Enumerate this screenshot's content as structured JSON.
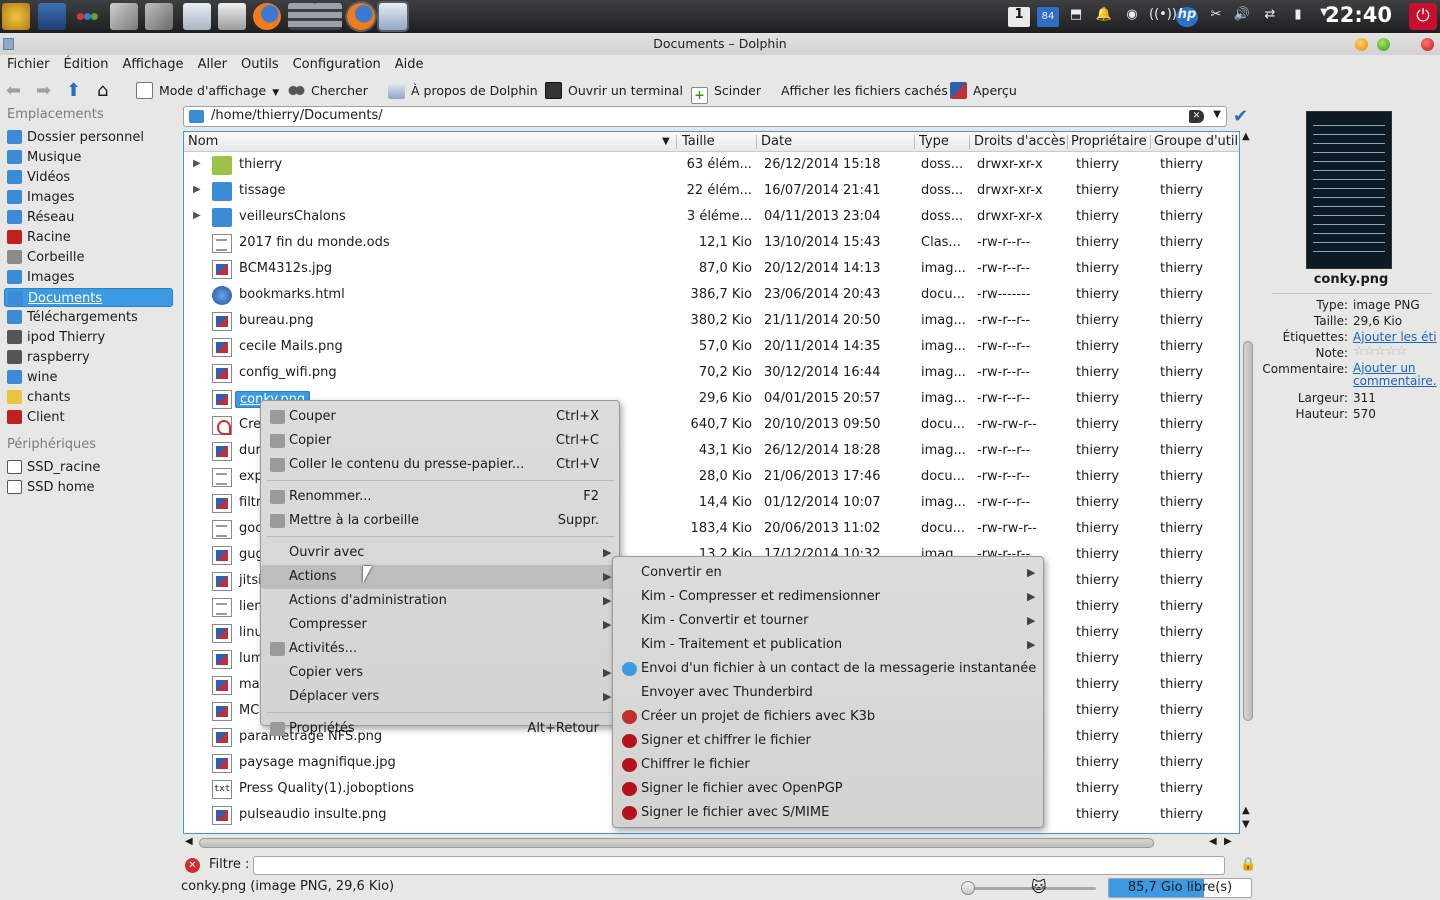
{
  "taskbar": {
    "clock": "22:40",
    "workspace": "1",
    "tray_badge": "84",
    "power_glyph": "⏻"
  },
  "window": {
    "title": "Documents – Dolphin"
  },
  "menubar": [
    "Fichier",
    "Édition",
    "Affichage",
    "Aller",
    "Outils",
    "Configuration",
    "Aide"
  ],
  "toolbar": {
    "view_mode": "Mode d'affichage",
    "search": "Chercher",
    "about": "À propos de Dolphin",
    "terminal": "Ouvrir un terminal",
    "split": "Scinder",
    "hidden": "Afficher les fichiers cachés",
    "preview": "Aperçu"
  },
  "places": {
    "header": "Emplacements",
    "items": [
      {
        "label": "Dossier personnel",
        "icon": "home-folder-icon",
        "color": "#3b8bd6"
      },
      {
        "label": "Musique",
        "icon": "music-folder-icon",
        "color": "#3b8bd6"
      },
      {
        "label": "Vidéos",
        "icon": "videos-folder-icon",
        "color": "#3b8bd6"
      },
      {
        "label": "Images",
        "icon": "pictures-folder-icon",
        "color": "#3b8bd6"
      },
      {
        "label": "Réseau",
        "icon": "network-icon",
        "color": "#3b8bd6"
      },
      {
        "label": "Racine",
        "icon": "root-folder-icon",
        "color": "#c21f1f"
      },
      {
        "label": "Corbeille",
        "icon": "trash-icon",
        "color": "#8c8c8c"
      },
      {
        "label": "Images",
        "icon": "pictures-folder-icon",
        "color": "#3b8bd6"
      },
      {
        "label": "Documents",
        "icon": "documents-folder-icon",
        "color": "#3b8bd6",
        "selected": true
      },
      {
        "label": "Téléchargements",
        "icon": "downloads-folder-icon",
        "color": "#3b8bd6"
      },
      {
        "label": "ipod Thierry",
        "icon": "media-player-icon",
        "color": "#555555"
      },
      {
        "label": "raspberry",
        "icon": "folder-icon",
        "color": "#555555"
      },
      {
        "label": "wine",
        "icon": "folder-icon",
        "color": "#3b8bd6"
      },
      {
        "label": "chants",
        "icon": "folder-icon",
        "color": "#e6c640"
      },
      {
        "label": "Client",
        "icon": "folder-icon",
        "color": "#c21f1f"
      }
    ],
    "devices_header": "Périphériques",
    "devices": [
      {
        "label": "SSD_racine",
        "icon": "drive-icon"
      },
      {
        "label": "SSD home",
        "icon": "drive-icon"
      }
    ]
  },
  "location": {
    "path": "/home/thierry/Documents/"
  },
  "columns": {
    "name": "Nom",
    "size": "Taille",
    "date": "Date",
    "type": "Type",
    "perms": "Droits d'accès",
    "owner": "Propriétaire",
    "group": "Groupe d'util"
  },
  "files": [
    {
      "name": "thierry",
      "size": "63 élém...",
      "date": "26/12/2014 15:18",
      "type": "doss...",
      "perms": "drwxr-xr-x",
      "owner": "thierry",
      "group": "thierry",
      "kind": "folder-green",
      "expander": true
    },
    {
      "name": "tissage",
      "size": "22 élém...",
      "date": "16/07/2014 21:41",
      "type": "doss...",
      "perms": "drwxr-xr-x",
      "owner": "thierry",
      "group": "thierry",
      "kind": "folder",
      "expander": true
    },
    {
      "name": "veilleursChalons",
      "size": "3 éléme...",
      "date": "04/11/2013 23:04",
      "type": "doss...",
      "perms": "drwxr-xr-x",
      "owner": "thierry",
      "group": "thierry",
      "kind": "folder",
      "expander": true
    },
    {
      "name": "2017 fin du monde.ods",
      "size": "12,1 Kio",
      "date": "13/10/2014 15:43",
      "type": "Clas...",
      "perms": "-rw-r--r--",
      "owner": "thierry",
      "group": "thierry",
      "kind": "doc"
    },
    {
      "name": "BCM4312s.jpg",
      "size": "87,0 Kio",
      "date": "20/12/2014 14:13",
      "type": "imag...",
      "perms": "-rw-r--r--",
      "owner": "thierry",
      "group": "thierry",
      "kind": "img"
    },
    {
      "name": "bookmarks.html",
      "size": "386,7 Kio",
      "date": "23/06/2014 20:43",
      "type": "docu...",
      "perms": "-rw-------",
      "owner": "thierry",
      "group": "thierry",
      "kind": "web"
    },
    {
      "name": "bureau.png",
      "size": "380,2 Kio",
      "date": "21/11/2014 20:50",
      "type": "imag...",
      "perms": "-rw-r--r--",
      "owner": "thierry",
      "group": "thierry",
      "kind": "img"
    },
    {
      "name": "cecile Mails.png",
      "size": "57,0 Kio",
      "date": "20/11/2014 14:35",
      "type": "imag...",
      "perms": "-rw-r--r--",
      "owner": "thierry",
      "group": "thierry",
      "kind": "img"
    },
    {
      "name": "config_wifi.png",
      "size": "70,2 Kio",
      "date": "30/12/2014 16:44",
      "type": "imag...",
      "perms": "-rw-r--r--",
      "owner": "thierry",
      "group": "thierry",
      "kind": "img"
    },
    {
      "name": "conky.png",
      "size": "29,6 Kio",
      "date": "04/01/2015 20:57",
      "type": "imag...",
      "perms": "-rw-r--r--",
      "owner": "thierry",
      "group": "thierry",
      "kind": "img",
      "selected": true
    },
    {
      "name": "Cre",
      "size": "640,7 Kio",
      "date": "20/10/2013 09:50",
      "type": "docu...",
      "perms": "-rw-rw-r--",
      "owner": "thierry",
      "group": "thierry",
      "kind": "pdf"
    },
    {
      "name": "dur",
      "size": "43,1 Kio",
      "date": "26/12/2014 18:28",
      "type": "imag...",
      "perms": "-rw-r--r--",
      "owner": "thierry",
      "group": "thierry",
      "kind": "img"
    },
    {
      "name": "exp",
      "size": "28,0 Kio",
      "date": "21/06/2013 17:46",
      "type": "docu...",
      "perms": "-rw-r--r--",
      "owner": "thierry",
      "group": "thierry",
      "kind": "doc"
    },
    {
      "name": "filtr",
      "size": "14,4 Kio",
      "date": "01/12/2014 10:07",
      "type": "imag...",
      "perms": "-rw-r--r--",
      "owner": "thierry",
      "group": "thierry",
      "kind": "img"
    },
    {
      "name": "goo",
      "size": "183,4 Kio",
      "date": "20/06/2013 11:02",
      "type": "docu...",
      "perms": "-rw-rw-r--",
      "owner": "thierry",
      "group": "thierry",
      "kind": "doc"
    },
    {
      "name": "gug",
      "size": "13,2 Kio",
      "date": "17/12/2014 10:32",
      "type": "imag...",
      "perms": "-rw-r--r--",
      "owner": "thierry",
      "group": "thierry",
      "kind": "img"
    },
    {
      "name": "jitsi",
      "size": "",
      "date": "",
      "type": "",
      "perms": "",
      "owner": "thierry",
      "group": "thierry",
      "kind": "img"
    },
    {
      "name": "lien",
      "size": "",
      "date": "",
      "type": "",
      "perms": "",
      "owner": "thierry",
      "group": "thierry",
      "kind": "doc"
    },
    {
      "name": "linu",
      "size": "",
      "date": "",
      "type": "",
      "perms": "",
      "owner": "thierry",
      "group": "thierry",
      "kind": "img"
    },
    {
      "name": "lum",
      "size": "",
      "date": "",
      "type": "",
      "perms": "",
      "owner": "thierry",
      "group": "thierry",
      "kind": "img"
    },
    {
      "name": "mar",
      "size": "",
      "date": "",
      "type": "",
      "perms": "",
      "owner": "thierry",
      "group": "thierry",
      "kind": "img"
    },
    {
      "name": "MCC",
      "size": "",
      "date": "",
      "type": "",
      "perms": "",
      "owner": "thierry",
      "group": "thierry",
      "kind": "img"
    },
    {
      "name": "parametrage NFS.png",
      "size": "",
      "date": "",
      "type": "",
      "perms": "",
      "owner": "thierry",
      "group": "thierry",
      "kind": "img"
    },
    {
      "name": "paysage magnifique.jpg",
      "size": "",
      "date": "",
      "type": "",
      "perms": "",
      "owner": "thierry",
      "group": "thierry",
      "kind": "img"
    },
    {
      "name": "Press Quality(1).joboptions",
      "size": "",
      "date": "",
      "type": "",
      "perms": "",
      "owner": "thierry",
      "group": "thierry",
      "kind": "txt"
    },
    {
      "name": "pulseaudio insulte.png",
      "size": "",
      "date": "",
      "type": "",
      "perms": "",
      "owner": "thierry",
      "group": "thierry",
      "kind": "img"
    }
  ],
  "context_menu": {
    "items": [
      {
        "label": "Couper",
        "shortcut": "Ctrl+X",
        "icon": "cut-icon"
      },
      {
        "label": "Copier",
        "shortcut": "Ctrl+C",
        "icon": "copy-icon"
      },
      {
        "label": "Coller le contenu du presse-papier...",
        "shortcut": "Ctrl+V",
        "icon": "paste-icon"
      },
      {
        "sep": true
      },
      {
        "label": "Renommer...",
        "shortcut": "F2",
        "icon": "rename-icon"
      },
      {
        "label": "Mettre à la corbeille",
        "shortcut": "Suppr.",
        "icon": "trash-icon"
      },
      {
        "sep": true
      },
      {
        "label": "Ouvrir avec",
        "submenu": true
      },
      {
        "label": "Actions",
        "submenu": true,
        "highlighted": true
      },
      {
        "label": "Actions d'administration",
        "submenu": true
      },
      {
        "label": "Compresser",
        "submenu": true
      },
      {
        "label": "Activités...",
        "icon": "activities-icon"
      },
      {
        "label": "Copier vers",
        "submenu": true
      },
      {
        "label": "Déplacer vers",
        "submenu": true
      },
      {
        "sep": true
      },
      {
        "label": "Propriétés",
        "shortcut": "Alt+Retour",
        "icon": "properties-icon"
      }
    ]
  },
  "submenu": {
    "items": [
      {
        "label": "Convertir en",
        "submenu": true
      },
      {
        "label": "Kim - Compresser et redimensionner",
        "submenu": true
      },
      {
        "label": "Kim - Convertir et tourner",
        "submenu": true
      },
      {
        "label": "Kim - Traitement et publication",
        "submenu": true
      },
      {
        "label": "Envoi d'un fichier à un contact de la messagerie instantanée",
        "icon": "chat-icon",
        "color": "#3b9ae3"
      },
      {
        "label": "Envoyer avec Thunderbird"
      },
      {
        "label": "Créer un projet de fichiers avec K3b",
        "icon": "k3b-icon",
        "color": "#c0302a"
      },
      {
        "label": "Signer et chiffrer le fichier",
        "icon": "kgpg-icon",
        "color": "#b5121b"
      },
      {
        "label": "Chiffrer le fichier",
        "icon": "kgpg-icon",
        "color": "#b5121b"
      },
      {
        "label": "Signer le fichier avec OpenPGP",
        "icon": "kgpg-icon",
        "color": "#b5121b"
      },
      {
        "label": "Signer le fichier avec S/MIME",
        "icon": "kgpg-icon",
        "color": "#b5121b"
      }
    ]
  },
  "info_panel": {
    "filename": "conky.png",
    "type_label": "Type:",
    "type_value": "image PNG",
    "size_label": "Taille:",
    "size_value": "29,6 Kio",
    "tags_label": "Étiquettes:",
    "tags_value": "Ajouter les éti",
    "rating_label": "Note:",
    "rating_stars": 0,
    "comment_label": "Commentaire:",
    "comment_value": "Ajouter un commentaire.",
    "width_label": "Largeur:",
    "width_value": "311",
    "height_label": "Hauteur:",
    "height_value": "570"
  },
  "filter": {
    "label": "Filtre :",
    "value": ""
  },
  "status": {
    "text": "conky.png (image PNG, 29,6 Kio)",
    "free_space": "85,7 Gio libre(s)",
    "zoom_level": 0.05
  },
  "colors": {
    "selection": "#3b9ae3",
    "accent": "#1b63c4"
  }
}
